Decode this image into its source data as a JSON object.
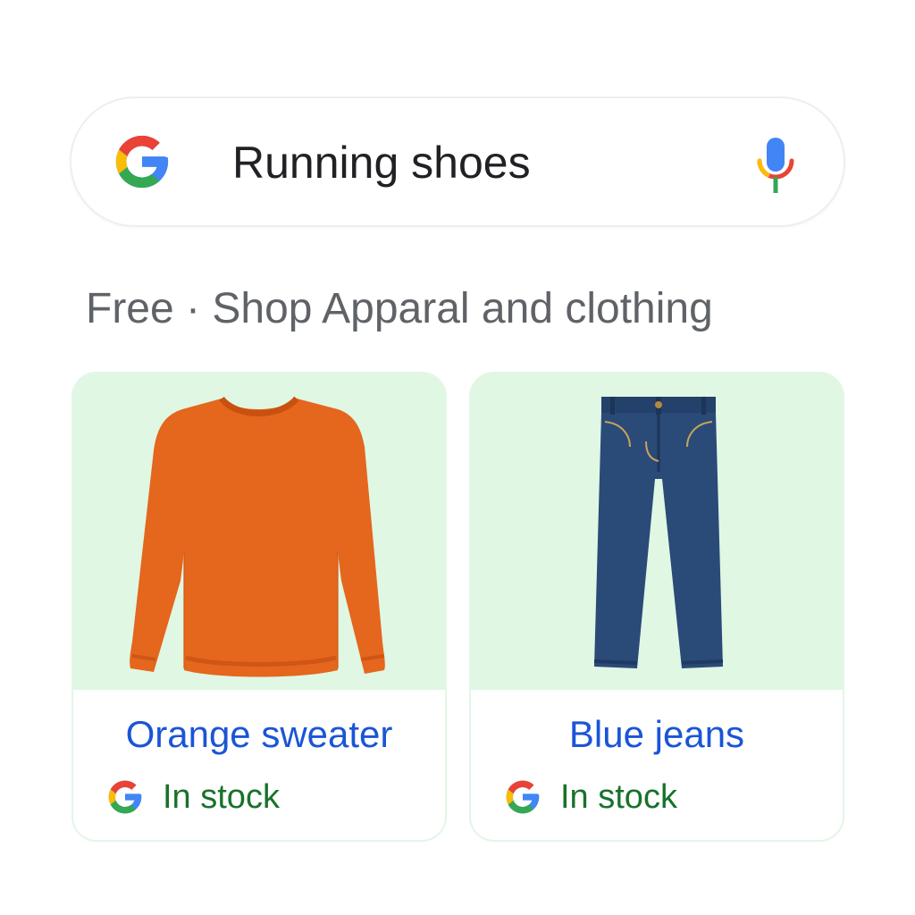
{
  "search": {
    "query": "Running shoes",
    "logo_icon": "google-g-icon",
    "mic_icon": "microphone-icon"
  },
  "heading": {
    "text": "Free · Shop Apparal and clothing"
  },
  "products": [
    {
      "title": "Orange sweater",
      "stock": "In stock",
      "image_icon": "orange-sweater-image"
    },
    {
      "title": "Blue jeans",
      "stock": "In stock",
      "image_icon": "blue-jeans-image"
    }
  ],
  "colors": {
    "link_blue": "#1a55d6",
    "stock_green": "#17722b",
    "card_bg_green": "#dff7e3",
    "google_blue": "#4285f4",
    "google_red": "#ea4335",
    "google_yellow": "#fbbc05",
    "google_green": "#34a853"
  }
}
